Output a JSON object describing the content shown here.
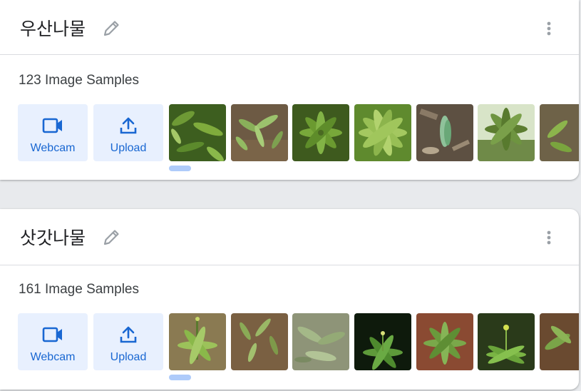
{
  "classes": [
    {
      "title": "우산나물",
      "sample_count": "123 Image Samples",
      "webcam_label": "Webcam",
      "upload_label": "Upload",
      "thumbnails": [
        "plant-photo",
        "plant-photo",
        "plant-photo",
        "plant-photo",
        "plant-photo",
        "plant-photo",
        "plant-photo"
      ]
    },
    {
      "title": "삿갓나물",
      "sample_count": "161 Image Samples",
      "webcam_label": "Webcam",
      "upload_label": "Upload",
      "thumbnails": [
        "plant-photo",
        "plant-photo",
        "plant-photo",
        "plant-photo",
        "plant-photo",
        "plant-photo",
        "plant-photo"
      ]
    }
  ],
  "colors": {
    "accent": "#1967d2",
    "button_bg": "#e8f0fe",
    "scroll_indicator": "#aecbfa",
    "page_bg": "#e8eaed"
  }
}
